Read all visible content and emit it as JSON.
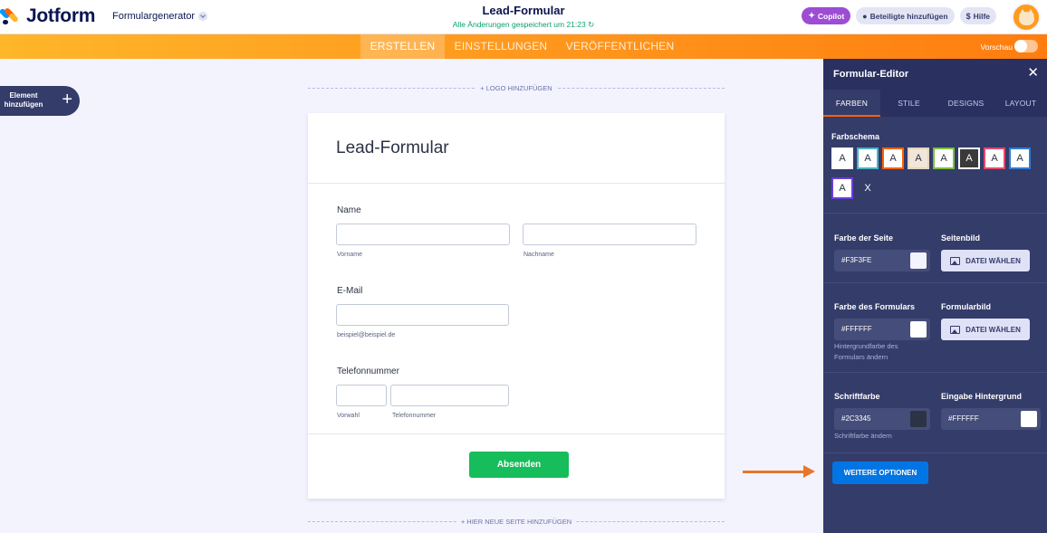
{
  "header": {
    "brand": "Jotform",
    "form_generator": "Formulargenerator",
    "form_title": "Lead-Formular",
    "save_status": "Alle Änderungen gespeichert um 21:23",
    "copilot": "Copilot",
    "add_participants": "Beteiligte hinzufügen",
    "help": "Hilfe"
  },
  "nav": {
    "tabs": [
      "ERSTELLEN",
      "EINSTELLUNGEN",
      "VERÖFFENTLICHEN"
    ],
    "active_tab": "ERSTELLEN",
    "preview_label": "Vorschau",
    "preview_on": false
  },
  "sidebar": {
    "add_element": "Element hinzufügen"
  },
  "canvas": {
    "add_logo": "+ LOGO HINZUFÜGEN",
    "add_page": "+ HIER NEUE SEITE HINZUFÜGEN",
    "form_heading": "Lead-Formular",
    "fields": {
      "name_label": "Name",
      "first_name_sub": "Vorname",
      "last_name_sub": "Nachname",
      "email_label": "E-Mail",
      "email_sub": "beispiel@beispiel.de",
      "phone_label": "Telefonnummer",
      "area_code_sub": "Vorwahl",
      "phone_sub": "Telefonnummer"
    },
    "submit": "Absenden"
  },
  "panel": {
    "title": "Formular-Editor",
    "tabs": [
      "FARBEN",
      "STILE",
      "DESIGNS",
      "LAYOUT"
    ],
    "active_tab": "FARBEN",
    "scheme_label": "Farbschema",
    "swatches": [
      {
        "text": "A",
        "bg": "#ffffff",
        "border": "#ffffff",
        "fg": "#2c3345"
      },
      {
        "text": "A",
        "bg": "#ffffff",
        "border": "#4ab3c6",
        "fg": "#2c3345"
      },
      {
        "text": "A",
        "bg": "#ffffff",
        "border": "#ff6100",
        "fg": "#2c3345"
      },
      {
        "text": "A",
        "bg": "#f1e6d8",
        "border": "#e3d6c1",
        "fg": "#2c3345"
      },
      {
        "text": "A",
        "bg": "#ffffff",
        "border": "#7dbf3c",
        "fg": "#2c3345"
      },
      {
        "text": "A",
        "bg": "#3a3a3a",
        "border": "#ffffff",
        "fg": "#ffffff"
      },
      {
        "text": "A",
        "bg": "#ffffff",
        "border": "#e14b6e",
        "fg": "#2c3345"
      },
      {
        "text": "A",
        "bg": "#ffffff",
        "border": "#2f7dd1",
        "fg": "#2c3345"
      },
      {
        "text": "A",
        "bg": "#ffffff",
        "border": "#6b3ed8",
        "fg": "#2c3345"
      },
      {
        "text": "X",
        "bg": "#343c6a",
        "border": "#343c6a",
        "fg": "#ffffff"
      }
    ],
    "page_color_label": "Farbe der Seite",
    "page_color": "#F3F3FE",
    "page_image_label": "Seitenbild",
    "choose_file": "DATEI WÄHLEN",
    "form_color_label": "Farbe des Formulars",
    "form_color": "#FFFFFF",
    "form_color_hint": "Hintergrundfarbe des Formulars ändern",
    "form_image_label": "Formularbild",
    "font_color_label": "Schriftfarbe",
    "font_color": "#2C3345",
    "font_color_hint": "Schriftfarbe ändern",
    "input_bg_label": "Eingabe Hintergrund",
    "input_bg": "#FFFFFF",
    "more_options": "WEITERE OPTIONEN"
  }
}
